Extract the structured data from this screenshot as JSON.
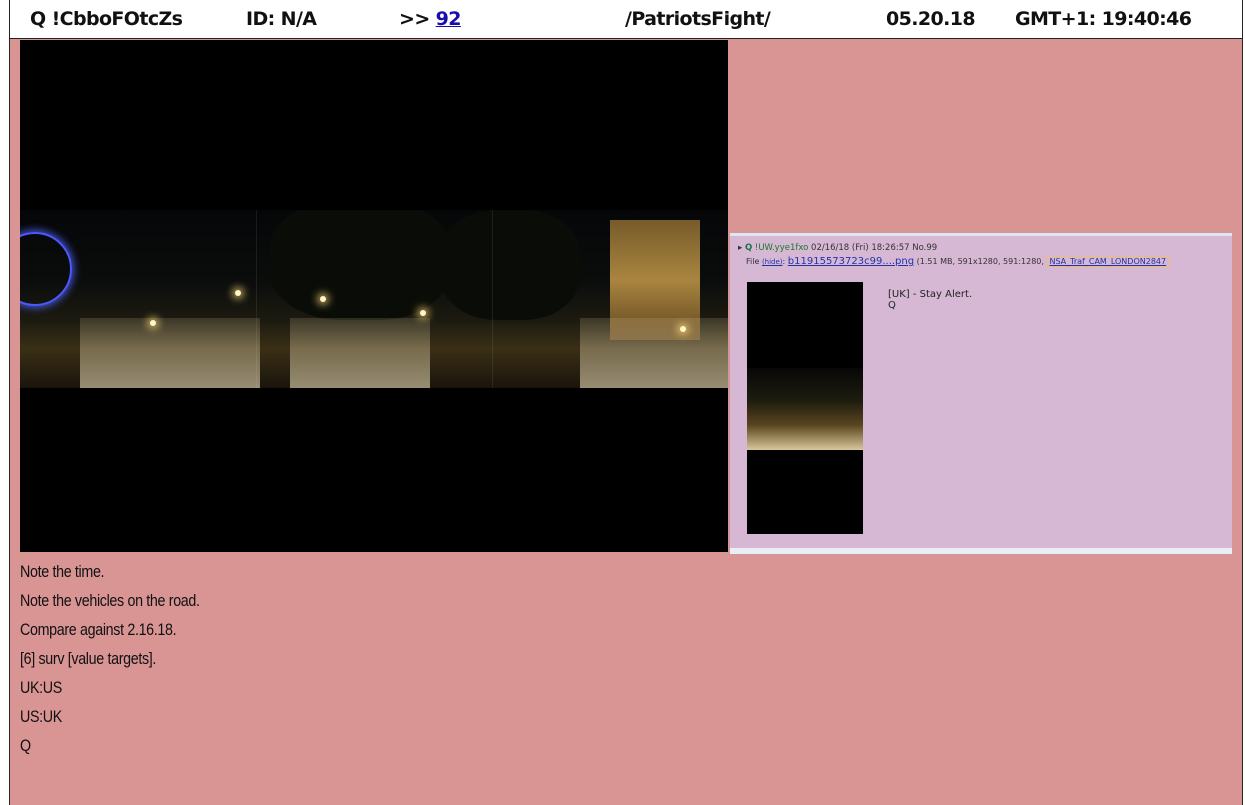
{
  "header": {
    "tripcode": "Q !CbboFOtcZs",
    "id": "ID: N/A",
    "ref_prefix": ">>",
    "ref_number": "92",
    "board": "/PatriotsFight/",
    "date": "05.20.18",
    "time": "GMT+1: 19:40:46"
  },
  "images": {
    "main_photo": "night-traffic-panorama-image",
    "inset": {
      "header_name": "Q",
      "header_trip": "!UW.yye1fxo",
      "header_rest": "02/16/18 (Fri) 18:26:57 No.99",
      "file_label": "File",
      "file_hide": "(hide)",
      "file_link": "b11915573723c99....png",
      "file_meta": "(1.51 MB, 591x1280, 591:1280,",
      "file_source": "NSA_Traf_CAM_LONDON2847",
      "message_lines": [
        "[UK] - Stay Alert.",
        "Q"
      ]
    }
  },
  "post": {
    "lines": [
      "Note the time.",
      "Note the vehicles on the road.",
      "Compare against 2.16.18.",
      "[6] surv [value targets].",
      "UK:US",
      "US:UK",
      "Q"
    ]
  },
  "colors": {
    "post_background": "#d99494",
    "header_background": "#ffffff",
    "link": "#1a0dab",
    "inset_background": "#d6b7d4"
  }
}
